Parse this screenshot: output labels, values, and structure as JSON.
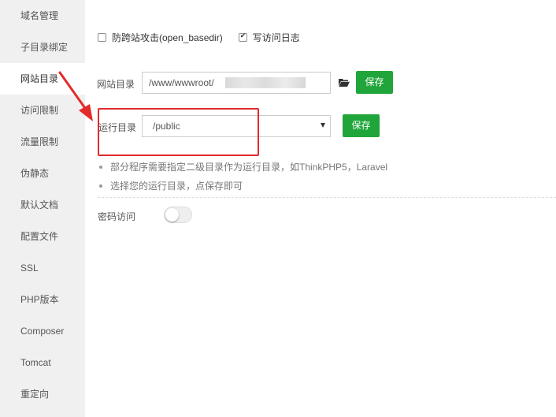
{
  "sidebar": {
    "items": [
      {
        "label": "域名管理"
      },
      {
        "label": "子目录绑定"
      },
      {
        "label": "网站目录"
      },
      {
        "label": "访问限制"
      },
      {
        "label": "流量限制"
      },
      {
        "label": "伪静态"
      },
      {
        "label": "默认文档"
      },
      {
        "label": "配置文件"
      },
      {
        "label": "SSL"
      },
      {
        "label": "PHP版本"
      },
      {
        "label": "Composer"
      },
      {
        "label": "Tomcat"
      },
      {
        "label": "重定向"
      }
    ],
    "active": "网站目录"
  },
  "options": {
    "anti_xss": {
      "label": "防跨站攻击(open_basedir)",
      "checked": false
    },
    "access_log": {
      "label": "写访问日志",
      "checked": true
    }
  },
  "site_dir": {
    "label": "网站目录",
    "value": "/www/wwwroot/",
    "save_label": "保存"
  },
  "run_dir": {
    "label": "运行目录",
    "value": "/public",
    "save_label": "保存"
  },
  "tips": [
    "部分程序需要指定二级目录作为运行目录，如ThinkPHP5，Laravel",
    "选择您的运行目录，点保存即可"
  ],
  "password_access": {
    "label": "密码访问",
    "enabled": false
  },
  "colors": {
    "accent_green": "#20a53a",
    "annotation_red": "#e32b2b",
    "sidebar_bg": "#f0f0f0"
  }
}
